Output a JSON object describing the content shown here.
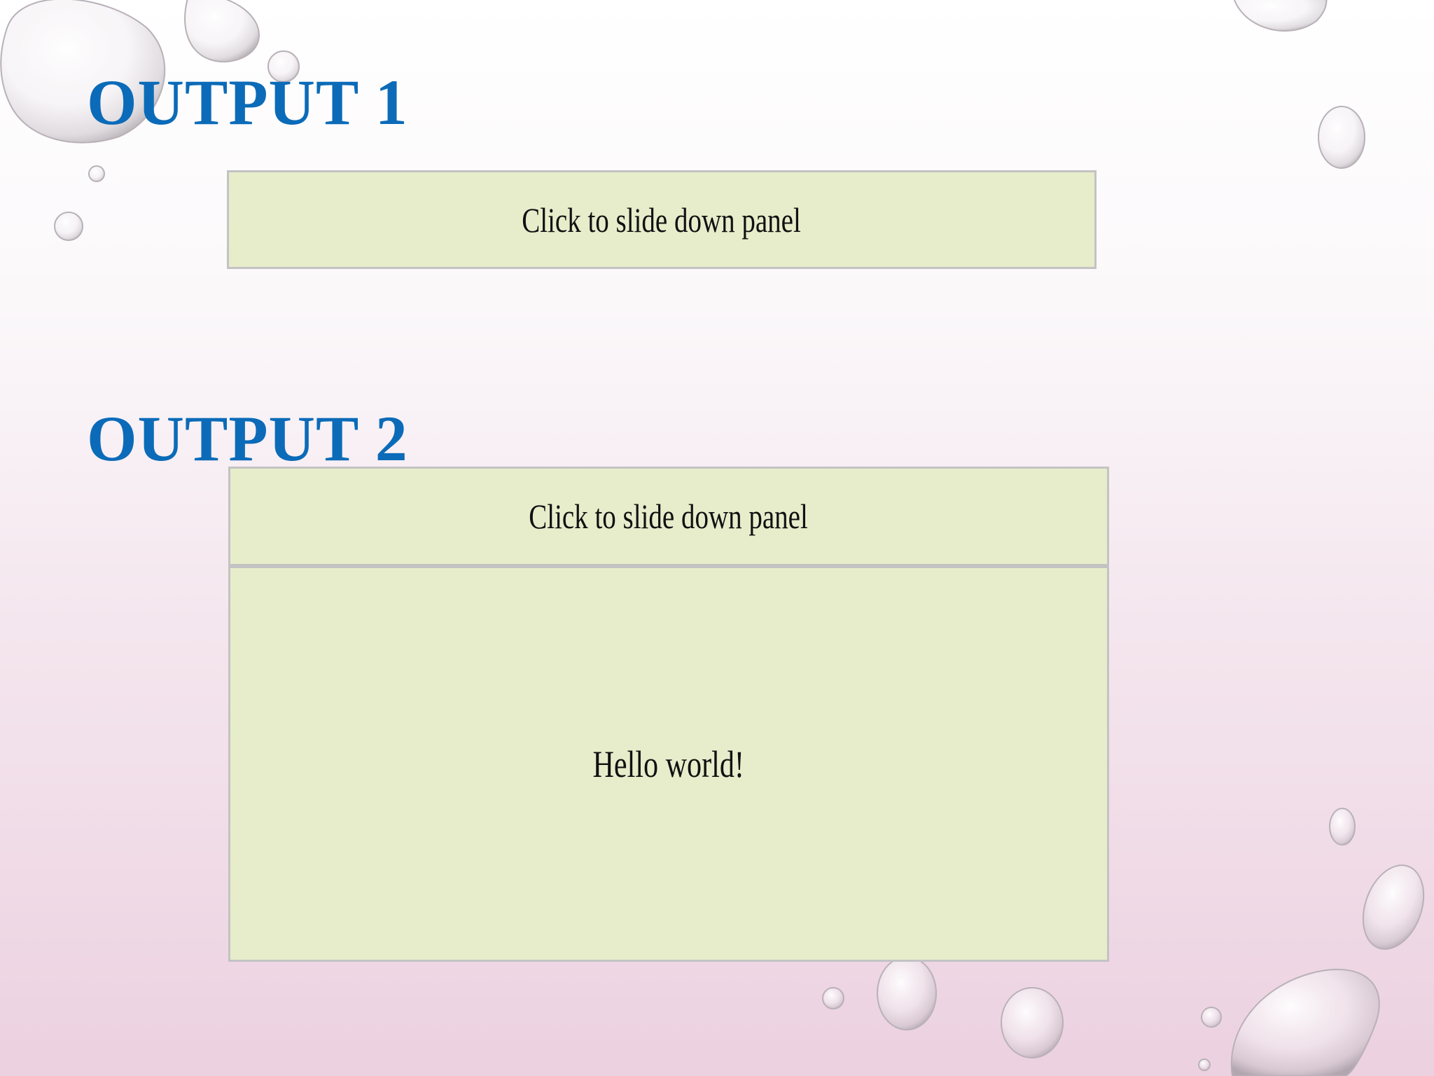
{
  "slide": {
    "output1_heading": "OUTPUT 1",
    "output2_heading": "OUTPUT 2"
  },
  "output1": {
    "button_label": "Click to slide down panel"
  },
  "output2": {
    "button_label": "Click to slide down panel",
    "panel_text": "Hello world!"
  },
  "colors": {
    "heading": "#0b6bb8",
    "panel_fill": "#e7edcb",
    "panel_border": "#c3c3c3"
  }
}
